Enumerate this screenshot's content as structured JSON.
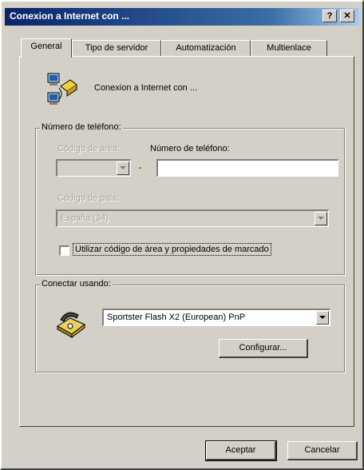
{
  "window": {
    "title": "Conexion a Internet con ...",
    "help_glyph": "?",
    "close_glyph": "✕"
  },
  "tabs": [
    {
      "label": "General",
      "active": true
    },
    {
      "label": "Tipo de servidor",
      "active": false
    },
    {
      "label": "Automatización",
      "active": false
    },
    {
      "label": "Multienlace",
      "active": false
    }
  ],
  "connection": {
    "name": "Conexion a Internet con ..."
  },
  "phone_group": {
    "title": "Número de teléfono:",
    "area_code_label": "Código de área:",
    "area_code_value": "",
    "dash": "-",
    "phone_label": "Número de teléfono:",
    "phone_value": "",
    "country_label": "Código de país:",
    "country_value": "España (34)",
    "use_area_label": "Utilizar código de área y propiedades de marcado",
    "use_area_checked": false
  },
  "connect_group": {
    "title": "Conectar usando:",
    "modem_value": "Sportster Flash X2 (European) PnP",
    "configure_label": "Configurar..."
  },
  "footer": {
    "ok_label": "Aceptar",
    "cancel_label": "Cancelar"
  },
  "colors": {
    "title_start": "#0a246a",
    "title_end": "#a6caf0",
    "face": "#d4d0c8"
  }
}
